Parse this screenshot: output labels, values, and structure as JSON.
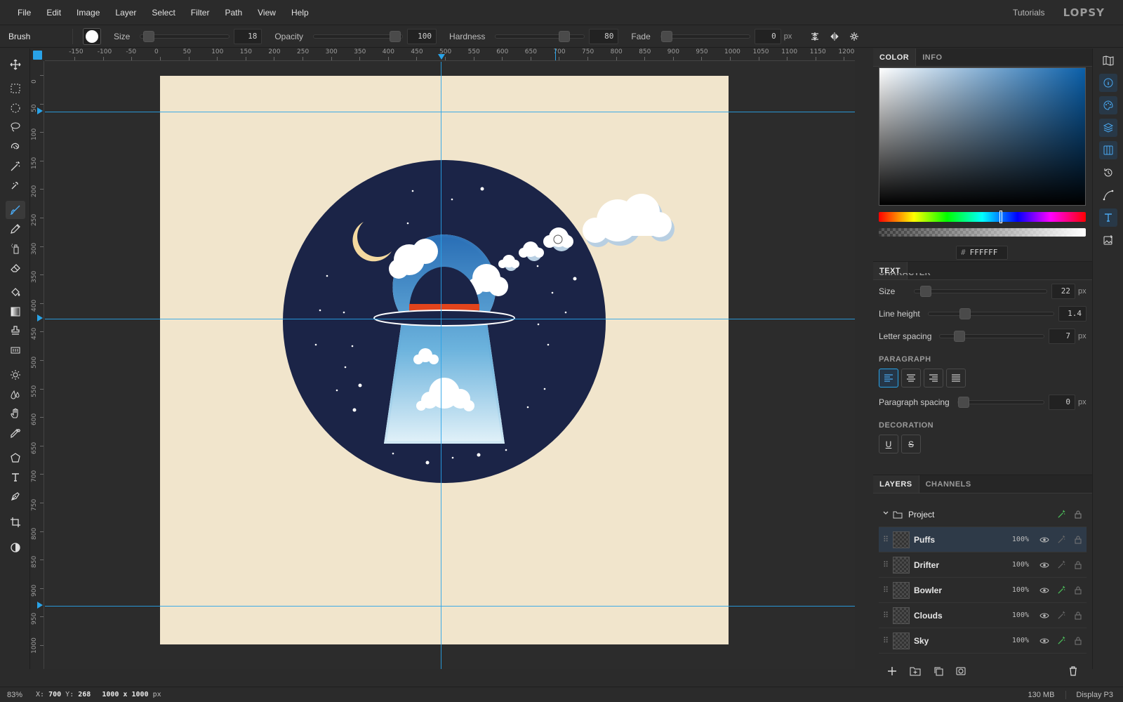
{
  "menu": {
    "items": [
      "File",
      "Edit",
      "Image",
      "Layer",
      "Select",
      "Filter",
      "Path",
      "View",
      "Help"
    ],
    "tutorials": "Tutorials",
    "logo": "LOPSY"
  },
  "options": {
    "tool_name": "Brush",
    "size_label": "Size",
    "size_value": "18",
    "opacity_label": "Opacity",
    "opacity_value": "100",
    "hardness_label": "Hardness",
    "hardness_value": "80",
    "fade_label": "Fade",
    "fade_value": "0",
    "fade_unit": "px",
    "brush_color": "#ffffff"
  },
  "tools": [
    "move-icon",
    "rect-select-icon",
    "ellipse-select-icon",
    "lasso-icon",
    "magnetic-lasso-icon",
    "magic-wand-icon",
    "quick-select-icon",
    "brush-icon",
    "pencil-icon",
    "spray-icon",
    "eraser-icon",
    "paint-bucket-icon",
    "gradient-icon",
    "stamp-icon",
    "pattern-stamp-icon",
    "dodge-icon",
    "blur-icon",
    "hand-icon",
    "eyedropper-icon",
    "polygon-icon",
    "type-icon",
    "pen-icon",
    "crop-icon",
    "contrast-icon"
  ],
  "ruler": {
    "h_labels": [
      "-150",
      "-100",
      "-50",
      "0",
      "50",
      "100",
      "150",
      "200",
      "250",
      "300",
      "350",
      "400",
      "450",
      "500",
      "550",
      "600",
      "650",
      "700",
      "750",
      "800",
      "850",
      "900",
      "950",
      "1000",
      "1050",
      "1100",
      "1150",
      "1200"
    ],
    "v_labels": [
      "0",
      "50",
      "100",
      "150",
      "200",
      "250",
      "300",
      "350",
      "400",
      "450",
      "500",
      "550",
      "600",
      "650",
      "700",
      "750",
      "800",
      "850",
      "900",
      "950",
      "1000"
    ]
  },
  "panel": {
    "color_tab": "COLOR",
    "info_tab": "INFO",
    "hex_prefix": "#",
    "hex_value": "FFFFFF",
    "text_tab": "TEXT",
    "character_label": "CHARACTER",
    "size_label": "Size",
    "size_value": "22",
    "size_unit": "px",
    "line_height_label": "Line height",
    "line_height_value": "1.4",
    "letter_spacing_label": "Letter spacing",
    "letter_spacing_value": "7",
    "letter_spacing_unit": "px",
    "paragraph_label": "PARAGRAPH",
    "paragraph_spacing_label": "Paragraph spacing",
    "paragraph_spacing_value": "0",
    "paragraph_spacing_unit": "px",
    "decoration_label": "DECORATION",
    "underline": "U",
    "strike": "S",
    "accent": "#29a3e8"
  },
  "layers": {
    "layers_tab": "LAYERS",
    "channels_tab": "CHANNELS",
    "group": "Project",
    "items": [
      {
        "name": "Puffs",
        "opacity": "100%"
      },
      {
        "name": "Drifter",
        "opacity": "100%"
      },
      {
        "name": "Bowler",
        "opacity": "100%"
      },
      {
        "name": "Clouds",
        "opacity": "100%"
      },
      {
        "name": "Sky",
        "opacity": "100%"
      }
    ]
  },
  "status": {
    "zoom": "83%",
    "x_label": "X:",
    "x_value": "700",
    "y_label": "Y:",
    "y_value": "268",
    "dims": "1000 x 1000",
    "dims_unit": "px",
    "memory": "130 MB",
    "display": "Display P3"
  },
  "art": {
    "background": "#f1e5cc",
    "circle": "#1b2447",
    "moon": "#f4d9a0",
    "hat_band": "#e2441c"
  }
}
